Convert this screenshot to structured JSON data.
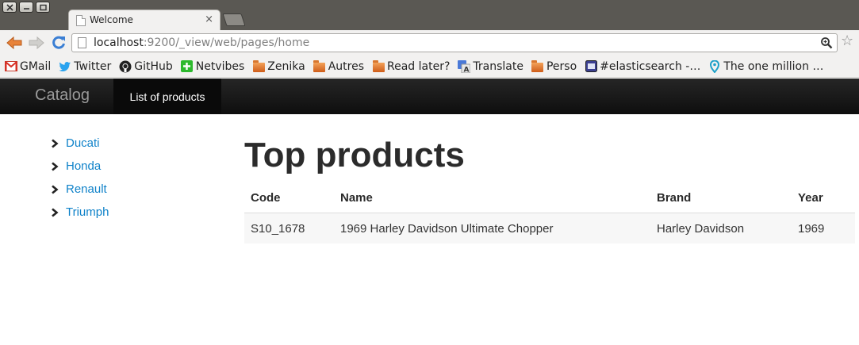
{
  "browser": {
    "tab_title": "Welcome",
    "tab_close": "×",
    "url_host": "localhost",
    "url_rest": ":9200/_view/web/pages/home"
  },
  "bookmarks": [
    {
      "label": "GMail",
      "icon": "gmail-icon"
    },
    {
      "label": "Twitter",
      "icon": "twitter-icon"
    },
    {
      "label": "GitHub",
      "icon": "github-icon"
    },
    {
      "label": "Netvibes",
      "icon": "netvibes-icon"
    },
    {
      "label": "Zenika",
      "icon": "folder-icon"
    },
    {
      "label": "Autres",
      "icon": "folder-icon"
    },
    {
      "label": "Read later?",
      "icon": "folder-icon"
    },
    {
      "label": "Translate",
      "icon": "translate-icon"
    },
    {
      "label": "Perso",
      "icon": "folder-icon"
    },
    {
      "label": "#elasticsearch -…",
      "icon": "irc-icon"
    },
    {
      "label": "The one million …",
      "icon": "map-pin-icon"
    }
  ],
  "navbar": {
    "brand": "Catalog",
    "active_item": "List of products"
  },
  "sidebar": {
    "items": [
      {
        "label": "Ducati"
      },
      {
        "label": "Honda"
      },
      {
        "label": "Renault"
      },
      {
        "label": "Triumph"
      }
    ]
  },
  "main": {
    "title": "Top products",
    "table": {
      "headers": [
        "Code",
        "Name",
        "Brand",
        "Year"
      ],
      "rows": [
        [
          "S10_1678",
          "1969 Harley Davidson Ultimate Chopper",
          "Harley Davidson",
          "1969"
        ]
      ]
    }
  },
  "colors": {
    "link": "#0f82c9",
    "navbar": "#1b1b1b",
    "chrome_frame": "#5a5853"
  }
}
